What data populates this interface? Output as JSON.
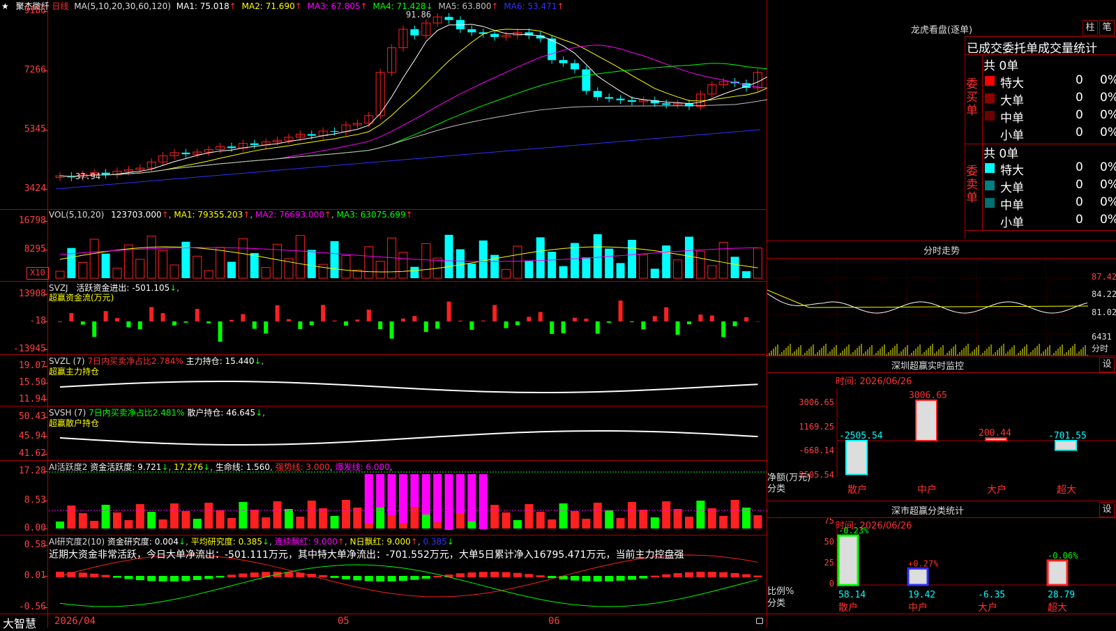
{
  "colors": {
    "up": "#ff2020",
    "down": "#00ffff",
    "ma1": "#ffffff",
    "ma2": "#ffff00",
    "ma3": "#ff00ff",
    "ma4": "#00ff00",
    "ma5": "#c0c0c0",
    "ma6": "#3030ff"
  },
  "header": {
    "star": "★",
    "stock_name": "聚杰微纤",
    "period": "日线",
    "ma_params": "MA(5,10,20,30,60,120)",
    "ma1": "MA1: 75.018",
    "ma2": "MA2: 71.690",
    "ma3": "MA3: 67.805",
    "ma4": "MA4: 71.428",
    "ma5": "MA5: 63.800",
    "ma6": "MA6: 53.471",
    "arrow_up": "↑",
    "arrow_down": "↓",
    "hi_label": "91.86",
    "lo_label": "37.94"
  },
  "main_axis": [
    "9186",
    "7266",
    "5345",
    "3424"
  ],
  "vol": {
    "head": "VOL(5,10,20)",
    "val": "123703.000",
    "ma1": "MA1: 79355.203",
    "ma2": "MA2: 76693.000",
    "ma3": "MA3: 63075.699",
    "axis": [
      "16798",
      "8295"
    ],
    "mult": "X10"
  },
  "svzj": {
    "head": "SVZJ",
    "label": "活跃资金进出: -501.105",
    "sub": "超赢资金流(万元)",
    "axis": [
      "13908",
      "-18",
      "-13945"
    ]
  },
  "svzl": {
    "head": "SVZL (7)",
    "pct": "7日内买卖净占比2.784%",
    "hold": "主力持仓: 15.440",
    "sub": "超赢主力持仓",
    "axis": [
      "19.07",
      "15.50",
      "11.94"
    ]
  },
  "svsh": {
    "head": "SVSH (7)",
    "pct": "7日内买卖净占比2.481%",
    "hold": "散户持仓: 46.645",
    "sub": "超赢散户持仓",
    "axis": [
      "50.43",
      "45.94",
      "41.62"
    ]
  },
  "ai1": {
    "head": "AI活跃度2",
    "act": "资金活跃度: 9.721",
    "v2": "17.276",
    "life": "生命线: 1.560",
    "strong": "强势线: 3.000",
    "burst": "爆发线: 6.000",
    "axis": [
      "17.28",
      "8.53",
      "0.00"
    ]
  },
  "ai2": {
    "head": "AI研究度2(10)",
    "research": "资金研究度: 0.004",
    "avg": "平均研究度: 0.385",
    "streak": "连续飘红: 9.000",
    "nday": "N日飘红: 9.000",
    "v5": "0.385",
    "axis": [
      "0.58",
      "0.01",
      "-0.56"
    ],
    "note": "近期大资金非常活跃，今日大单净流出：-501.111万元，其中特大单净流出：-701.552万元，大单5日累计净入16795.471万元，当前主力控盘强"
  },
  "bottom": {
    "brand": "大智慧",
    "date": "2026/04",
    "m05": "05",
    "m06": "06"
  },
  "lhb": {
    "title": "龙虎看盘(逐单)",
    "btn1": "柱",
    "btn2": "笔",
    "tabs": "已成交委托单成交量统计",
    "buy_side": "委买单",
    "sell_side": "委卖单",
    "buy_total": "共 0单",
    "sell_total": "共 0单",
    "buy_rows": [
      {
        "name": "特大",
        "color": "#ff0000",
        "n": "0",
        "p": "0%"
      },
      {
        "name": "大单",
        "color": "#8b0000",
        "n": "0",
        "p": "0%"
      },
      {
        "name": "中单",
        "color": "#6b0000",
        "n": "0",
        "p": "0%"
      },
      {
        "name": "小单",
        "color": "#000000",
        "n": "0",
        "p": "0%"
      }
    ],
    "sell_rows": [
      {
        "name": "特大",
        "color": "#00ffff",
        "n": "0",
        "p": "0%"
      },
      {
        "name": "大单",
        "color": "#008080",
        "n": "0",
        "p": "0%"
      },
      {
        "name": "中单",
        "color": "#007070",
        "n": "0",
        "p": "0%"
      },
      {
        "name": "小单",
        "color": "#000000",
        "n": "0",
        "p": "0%"
      }
    ]
  },
  "fenshi": {
    "title": "分时走势",
    "axis": [
      "87.42",
      "84.22",
      "81.02"
    ],
    "vol": "6431",
    "unit": "分时"
  },
  "sz1": {
    "title": "深圳超赢实时监控",
    "btn": "设",
    "time": "时间: 2026/06/26",
    "axis": [
      "3006.65",
      "1169.25",
      "-668.14",
      "-2505.54"
    ],
    "ylabel": "净额(万元)",
    "xlabel": "分类",
    "cats": [
      "散户",
      "中户",
      "大户",
      "超大"
    ],
    "values": [
      -2505.54,
      3006.65,
      200.44,
      -701.55
    ],
    "labels": [
      "-2505.54",
      "3006.65",
      "200.44",
      "-701.55"
    ]
  },
  "sz2": {
    "title": "深市超赢分类统计",
    "btn": "设",
    "time": "时间: 2026/06/26",
    "axis": [
      "75",
      "50",
      "25",
      "0"
    ],
    "ylabel": "比例%",
    "xlabel": "分类",
    "cats": [
      "散户",
      "中户",
      "大户",
      "超大"
    ],
    "values": [
      58.14,
      19.42,
      -6.35,
      28.79
    ],
    "labels": [
      "58.14",
      "19.42",
      "-6.35",
      "28.79"
    ],
    "changes": [
      "-0.23%",
      "+0.27%",
      "",
      "-0.06%"
    ]
  }
}
